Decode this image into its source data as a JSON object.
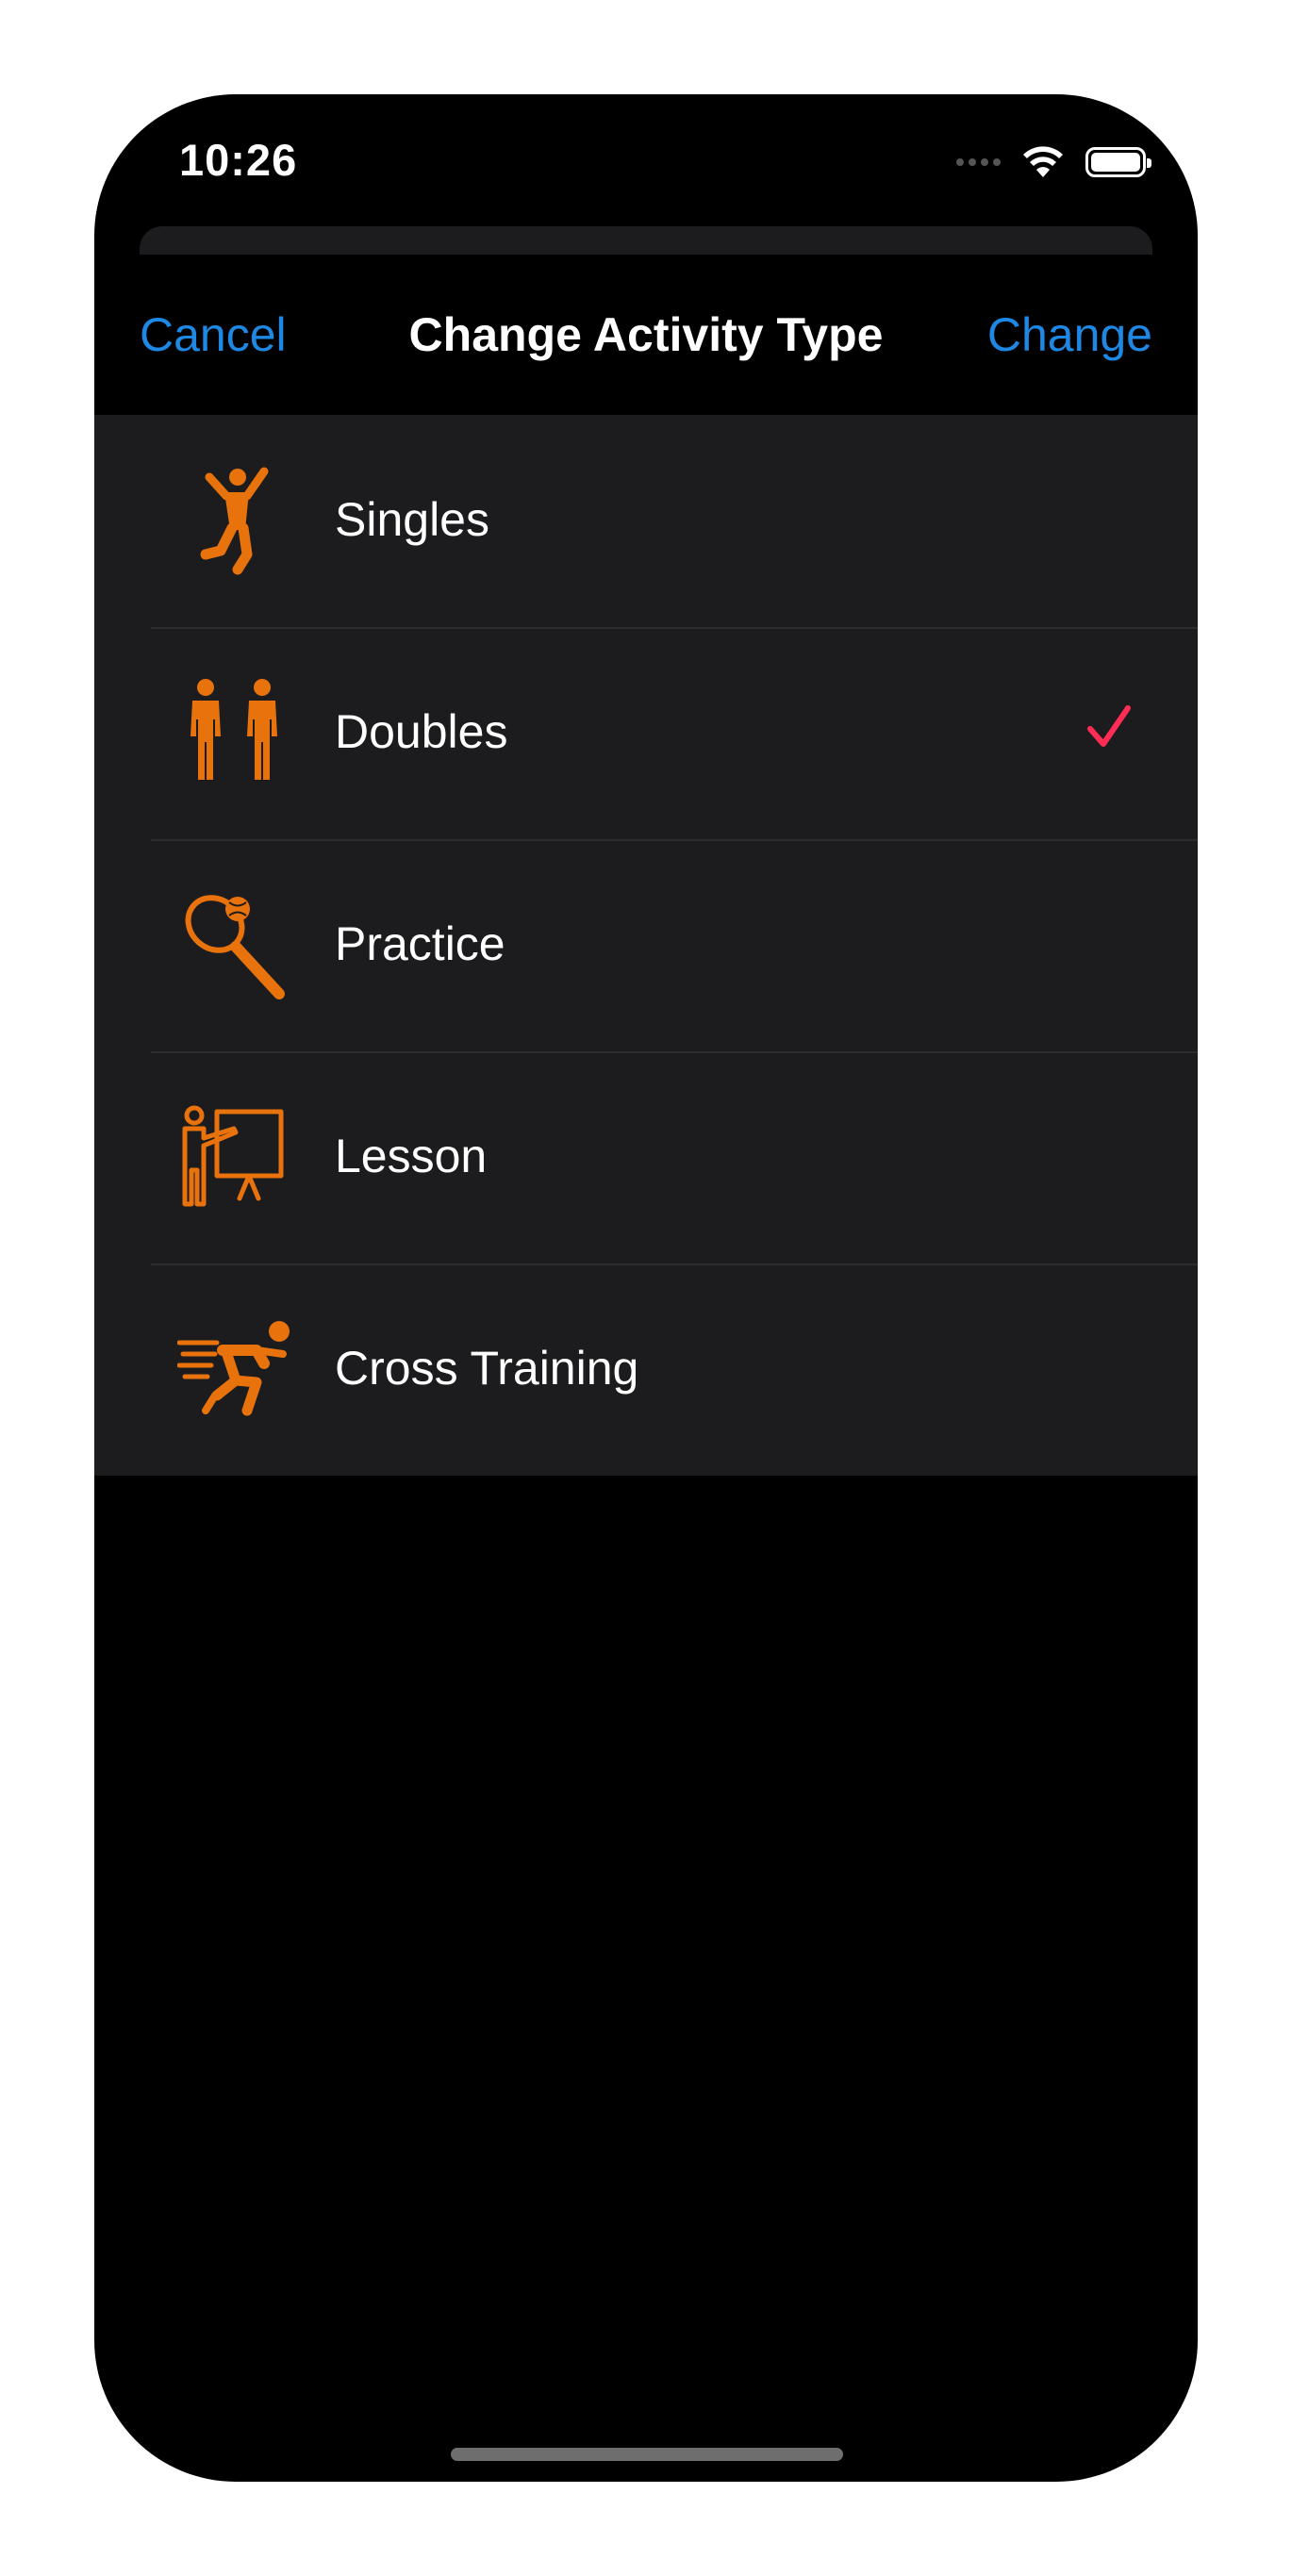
{
  "status_bar": {
    "time": "10:26",
    "icons": [
      "cellular-signal-icon",
      "wifi-icon",
      "battery-icon"
    ]
  },
  "nav": {
    "cancel_label": "Cancel",
    "title": "Change Activity Type",
    "change_label": "Change"
  },
  "activities": {
    "items": [
      {
        "label": "Singles",
        "icon": "singles-player-icon",
        "selected": false
      },
      {
        "label": "Doubles",
        "icon": "doubles-players-icon",
        "selected": true
      },
      {
        "label": "Practice",
        "icon": "tennis-racket-icon",
        "selected": false
      },
      {
        "label": "Lesson",
        "icon": "lesson-presenter-icon",
        "selected": false
      },
      {
        "label": "Cross Training",
        "icon": "sprinter-icon",
        "selected": false
      }
    ]
  },
  "colors": {
    "accent": "#1e88e5",
    "icon": "#e8720c",
    "checkmark": "#ff2d55",
    "row_background": "#1c1c1e",
    "background": "#000000"
  }
}
